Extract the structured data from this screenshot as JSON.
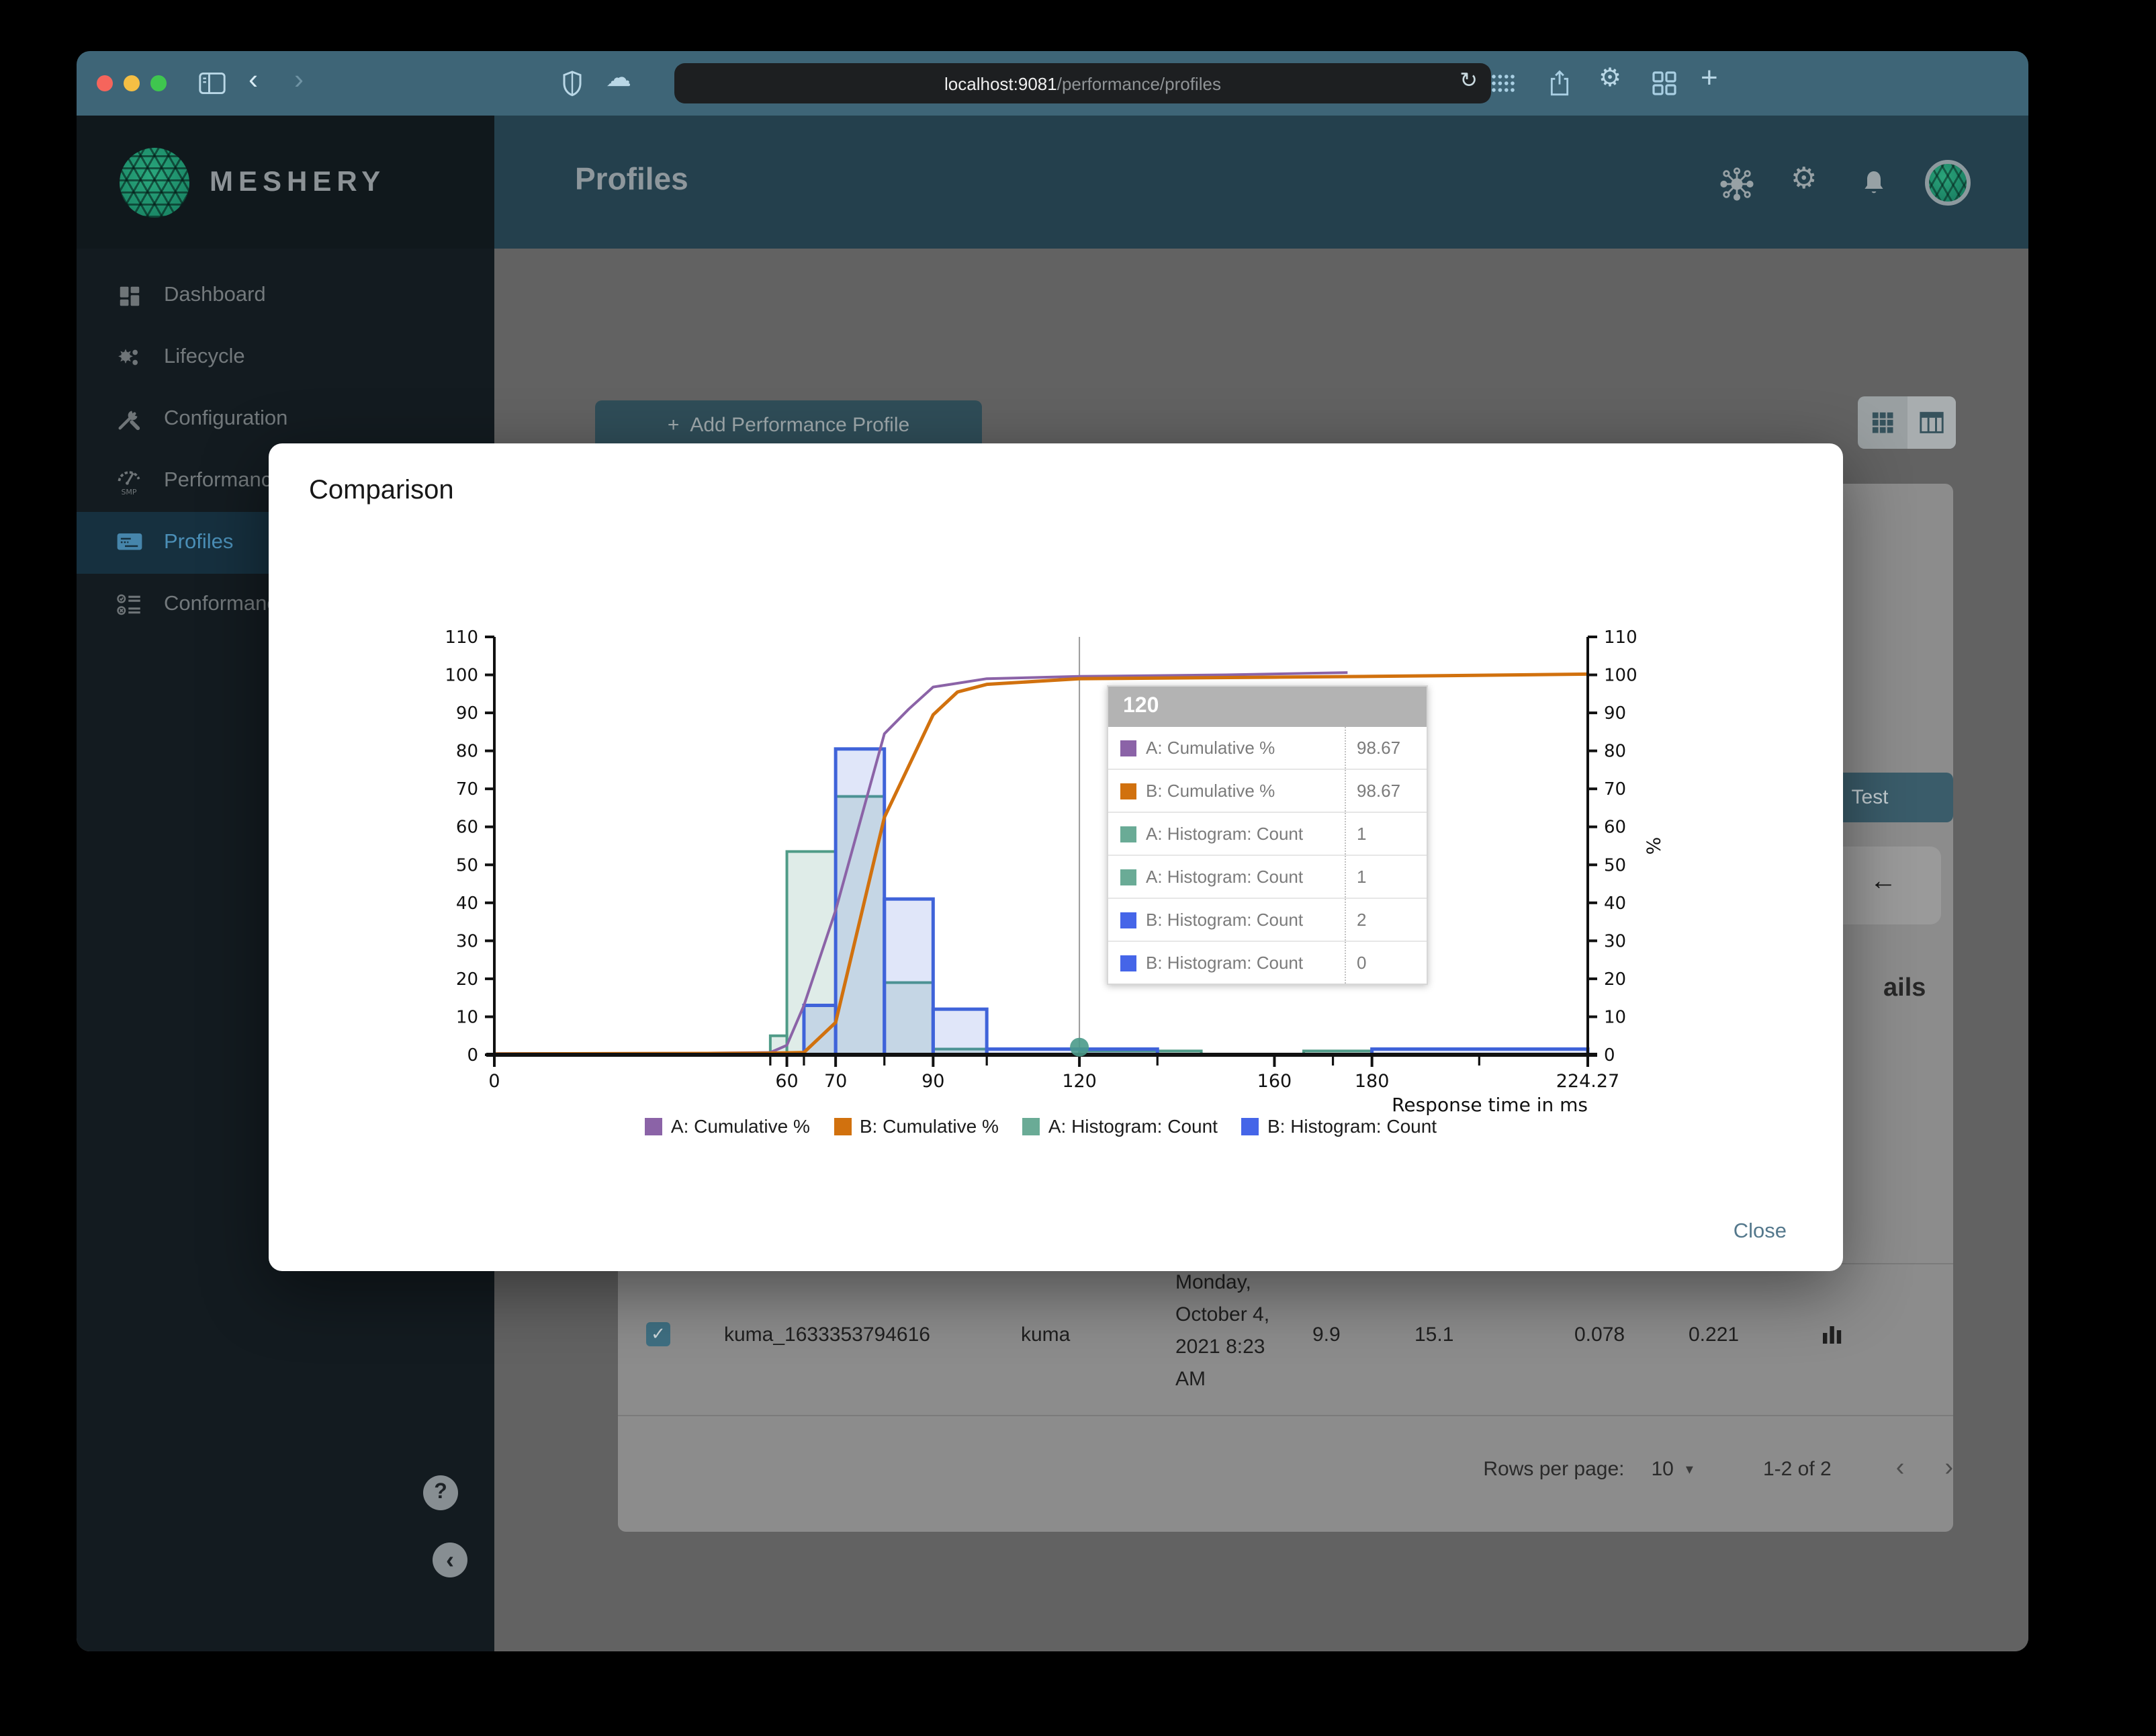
{
  "browser": {
    "url_host": "localhost:9081",
    "url_path": "/performance/profiles",
    "reload_glyph": "↻",
    "back_glyph": "‹",
    "forward_glyph": "›",
    "plus_glyph": "+",
    "cloud_glyph": "☁",
    "gear_glyph": "⚙"
  },
  "brand": {
    "name": "MESHERY"
  },
  "header": {
    "title": "Profiles",
    "gear_glyph": "⚙"
  },
  "sidebar": {
    "items": [
      {
        "label": "Dashboard",
        "icon": "dashboard-icon"
      },
      {
        "label": "Lifecycle",
        "icon": "lifecycle-icon"
      },
      {
        "label": "Configuration",
        "icon": "configuration-icon"
      },
      {
        "label": "Performance",
        "icon": "performance-icon"
      },
      {
        "label": "Profiles",
        "icon": "profiles-icon"
      },
      {
        "label": "Conformance",
        "icon": "conformance-icon"
      }
    ],
    "active_item": "Profiles",
    "performance_icon_text": "SMP",
    "help_glyph": "?",
    "collapse_glyph": "‹"
  },
  "content": {
    "add_button_plus": "+",
    "add_button_label": "Add Performance Profile",
    "test_button_label": "Test",
    "back_arrow_glyph": "←",
    "details_fragment": "ails",
    "row": {
      "checked_glyph": "✓",
      "name": "kuma_1633353794616",
      "mesh": "kuma",
      "date": "Monday, October 4, 2021 8:23 AM",
      "values": [
        "9.9",
        "15.1",
        "0.078",
        "0.221"
      ]
    },
    "pagination": {
      "rows_per_page_label": "Rows per page:",
      "rows_per_page_value": "10",
      "caret_glyph": "▾",
      "range": "1-2 of 2",
      "prev_glyph": "‹",
      "next_glyph": "›"
    }
  },
  "modal": {
    "title": "Comparison",
    "close_label": "Close",
    "tooltip": {
      "header": "120",
      "rows": [
        {
          "label": "A: Cumulative %",
          "value": "98.67",
          "color": "#8b63a7"
        },
        {
          "label": "B: Cumulative %",
          "value": "98.67",
          "color": "#d1710e"
        },
        {
          "label": "A: Histogram: Count",
          "value": "1",
          "color": "#6aab96"
        },
        {
          "label": "A: Histogram: Count",
          "value": "1",
          "color": "#6aab96"
        },
        {
          "label": "B: Histogram: Count",
          "value": "2",
          "color": "#4565e8"
        },
        {
          "label": "B: Histogram: Count",
          "value": "0",
          "color": "#4565e8"
        }
      ]
    }
  },
  "chart_data": {
    "type": "histogram+cumulative-line",
    "title": "Comparison",
    "xlabel": "Response time in ms",
    "right_axis_label": "%",
    "xlim": [
      0,
      224.27
    ],
    "ylim": [
      0,
      110
    ],
    "y_tick_step": 10,
    "x_ticks_labeled": [
      0,
      60,
      70,
      90,
      120,
      160,
      180,
      224.27
    ],
    "x_tick_labels": [
      "0",
      "60",
      "70",
      "90",
      "120",
      "160",
      "180",
      "224.27"
    ],
    "x_ticks_minor": [
      56.6,
      63.5,
      80,
      101,
      136,
      172,
      202
    ],
    "hover_x": 120,
    "hover_marker": {
      "x": 120,
      "y": 2,
      "color": "#4a9a8a"
    },
    "grid": false,
    "legend_position": "bottom",
    "legend": [
      {
        "label": "A: Cumulative %",
        "color": "#8b63a7"
      },
      {
        "label": "B: Cumulative %",
        "color": "#d1710e"
      },
      {
        "label": "A: Histogram: Count",
        "color": "#6aab96"
      },
      {
        "label": "B: Histogram: Count",
        "color": "#4565e8"
      }
    ],
    "series": [
      {
        "name": "A: Histogram: Count",
        "type": "bar",
        "stroke": "#4f9b87",
        "fill": "rgba(94,160,140,0.20)",
        "stroke_width": 2,
        "bins": [
          [
            56.6,
            60,
            5
          ],
          [
            60,
            70,
            53.5
          ],
          [
            70,
            80,
            68
          ],
          [
            80,
            90,
            19
          ],
          [
            90,
            101,
            1.5
          ],
          [
            120,
            145,
            1
          ],
          [
            166,
            180,
            1
          ]
        ]
      },
      {
        "name": "B: Histogram: Count",
        "type": "bar",
        "stroke": "#3f63d9",
        "fill": "rgba(63,99,217,0.16)",
        "stroke_width": 2.5,
        "bins": [
          [
            63.5,
            70,
            13
          ],
          [
            70,
            80,
            80.5
          ],
          [
            80,
            90,
            41
          ],
          [
            90,
            101,
            12
          ],
          [
            101,
            136,
            1.5
          ],
          [
            180,
            224.27,
            1.5
          ]
        ]
      },
      {
        "name": "A: Cumulative %",
        "type": "line",
        "stroke": "#8b63a7",
        "stroke_width": 2,
        "points": [
          [
            0,
            0.3
          ],
          [
            40,
            0.4
          ],
          [
            56.6,
            0.6
          ],
          [
            60,
            2.5
          ],
          [
            63.5,
            13
          ],
          [
            70,
            38
          ],
          [
            80,
            84.5
          ],
          [
            85,
            91
          ],
          [
            90,
            96.8
          ],
          [
            101,
            99
          ],
          [
            120,
            99.6
          ],
          [
            150,
            100
          ],
          [
            175,
            100.6
          ]
        ]
      },
      {
        "name": "B: Cumulative %",
        "type": "line",
        "stroke": "#d1710e",
        "stroke_width": 2.5,
        "points": [
          [
            0,
            0.2
          ],
          [
            55,
            0.4
          ],
          [
            63.5,
            0.6
          ],
          [
            70,
            8.5
          ],
          [
            80,
            62.5
          ],
          [
            90,
            89.5
          ],
          [
            95,
            95.5
          ],
          [
            101,
            97.5
          ],
          [
            120,
            99
          ],
          [
            160,
            99.4
          ],
          [
            180,
            99.6
          ],
          [
            224.27,
            100.2
          ]
        ]
      }
    ]
  }
}
